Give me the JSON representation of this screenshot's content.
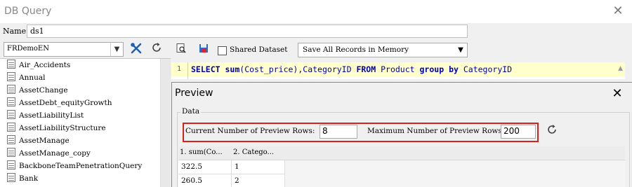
{
  "window": {
    "title": "DB Query"
  },
  "name_field": {
    "label": "Name:",
    "value": "ds1"
  },
  "datasource_select": {
    "value": "FRDemoEN"
  },
  "tables": [
    "Air_Accidents",
    "Annual",
    "AssetChange",
    "AssetDebt_equityGrowth",
    "AssetLiabilityList",
    "AssetLiabilityStructure",
    "AssetManage",
    "AssetManage_copy",
    "BackboneTeamPenetrationQuery",
    "Bank"
  ],
  "query_toolbar": {
    "shared_dataset_label": "Shared Dataset",
    "save_mode_value": "Save All Records in Memory"
  },
  "editor": {
    "line_number": "1",
    "sql_tokens": {
      "select": "SELECT",
      "sum": "sum",
      "args": "(Cost_price),CategoryID",
      "from": "FROM",
      "table": "Product",
      "group": "group",
      "by": "by",
      "groupcol": "CategoryID"
    }
  },
  "preview": {
    "title": "Preview",
    "data_legend": "Data",
    "current_rows_label": "Current Number of Preview Rows:",
    "current_rows_value": "8",
    "max_rows_label": "Maximum Number of Preview Rows:",
    "max_rows_value": "200",
    "columns": [
      "1. sum(Co...",
      "2. Catego..."
    ],
    "rows": [
      [
        "322.5",
        "1"
      ],
      [
        "260.5",
        "2"
      ]
    ]
  },
  "colors": {
    "highlight_border": "#d9211b",
    "sql_keyword": "#0000b0",
    "current_line": "#ffffcc"
  }
}
